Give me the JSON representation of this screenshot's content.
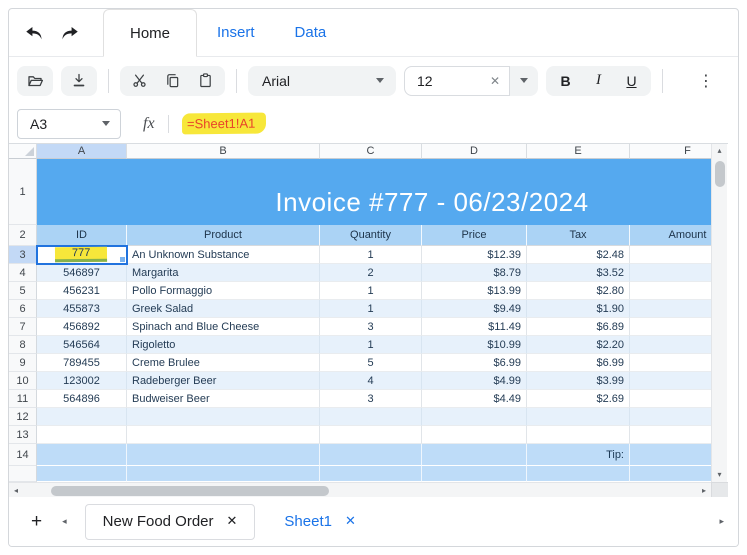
{
  "ribbon": {
    "tabs": [
      {
        "label": "Home",
        "active": true
      },
      {
        "label": "Insert",
        "active": false
      },
      {
        "label": "Data",
        "active": false
      }
    ]
  },
  "toolbar": {
    "font_name": "Arial",
    "font_size": "12",
    "bold": "B",
    "italic": "I",
    "underline": "U"
  },
  "formula_bar": {
    "name_box": "A3",
    "fx": "fx",
    "formula": "=Sheet1!A1"
  },
  "grid": {
    "column_headers": [
      "A",
      "B",
      "C",
      "D",
      "E",
      "F"
    ],
    "selected_column_index": 0,
    "banner": {
      "row": "1",
      "text": "Invoice #777 - 06/23/2024"
    },
    "header_row": {
      "row": "2",
      "cells": [
        "ID",
        "Product",
        "Quantity",
        "Price",
        "Tax",
        "Amount"
      ]
    },
    "data_rows": [
      {
        "row": "3",
        "cells": [
          "777",
          "An Unknown Substance",
          "1",
          "$12.39",
          "$2.48",
          ""
        ],
        "selected_cell": 0,
        "highlight_cell": 0
      },
      {
        "row": "4",
        "cells": [
          "546897",
          "Margarita",
          "2",
          "$8.79",
          "$3.52",
          ""
        ]
      },
      {
        "row": "5",
        "cells": [
          "456231",
          "Pollo Formaggio",
          "1",
          "$13.99",
          "$2.80",
          ""
        ]
      },
      {
        "row": "6",
        "cells": [
          "455873",
          "Greek Salad",
          "1",
          "$9.49",
          "$1.90",
          ""
        ]
      },
      {
        "row": "7",
        "cells": [
          "456892",
          "Spinach and Blue Cheese",
          "3",
          "$11.49",
          "$6.89",
          ""
        ]
      },
      {
        "row": "8",
        "cells": [
          "546564",
          "Rigoletto",
          "1",
          "$10.99",
          "$2.20",
          ""
        ]
      },
      {
        "row": "9",
        "cells": [
          "789455",
          "Creme Brulee",
          "5",
          "$6.99",
          "$6.99",
          ""
        ]
      },
      {
        "row": "10",
        "cells": [
          "123002",
          "Radeberger Beer",
          "4",
          "$4.99",
          "$3.99",
          ""
        ]
      },
      {
        "row": "11",
        "cells": [
          "564896",
          "Budweiser Beer",
          "3",
          "$4.49",
          "$2.69",
          ""
        ]
      }
    ],
    "empty_rows": [
      "12",
      "13"
    ],
    "tip_row": {
      "row": "14",
      "label": "Tip:",
      "label_column": 4
    }
  },
  "sheet_bar": {
    "add": "+",
    "tabs": [
      {
        "label": "New Food Order",
        "active": true
      },
      {
        "label": "Sheet1",
        "active": false
      }
    ]
  },
  "icons": {
    "close": "✕",
    "clear": "✕",
    "overflow": "⋮",
    "up": "▴",
    "down": "▾",
    "left": "◂",
    "right": "▸"
  },
  "colors": {
    "banner_blue": "#55a9ef",
    "header_blue": "#abd3f5",
    "band_blue": "#e7f1fb",
    "tip_blue": "#bedcf8",
    "selection_blue": "#2173de",
    "highlight_yellow": "#f7e73a",
    "formula_red": "#e8432a",
    "link_blue": "#1a73e8"
  }
}
